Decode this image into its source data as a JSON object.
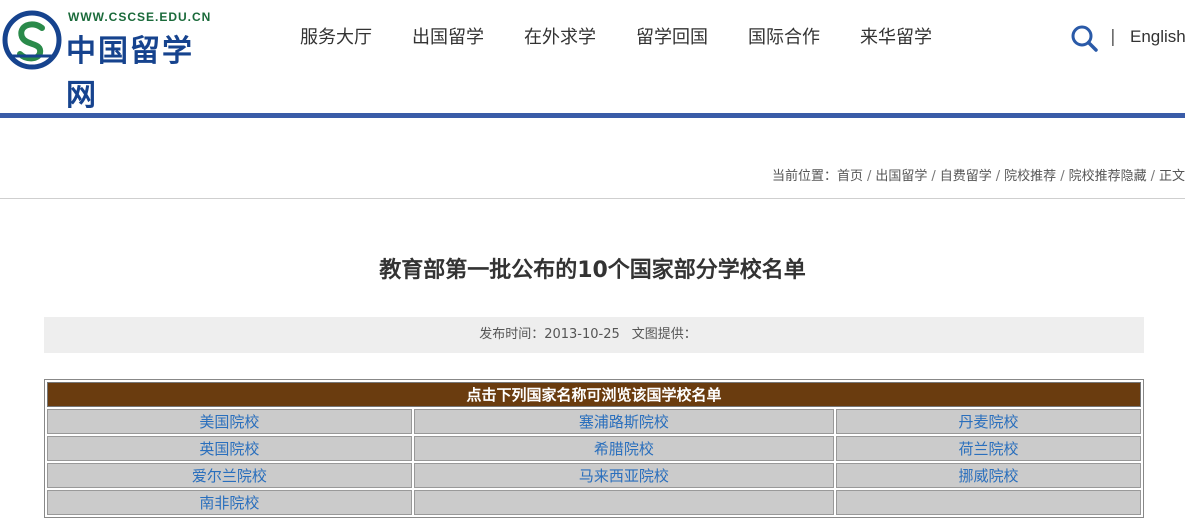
{
  "header": {
    "logo_url_text": "WWW.CSCSE.EDU.CN",
    "logo_cn_text": "中国留学网",
    "nav": [
      "服务大厅",
      "出国留学",
      "在外求学",
      "留学回国",
      "国际合作",
      "来华留学"
    ],
    "separator": "|",
    "english": "English"
  },
  "breadcrumb": {
    "prefix": "当前位置：",
    "items": [
      "首页",
      "出国留学",
      "自费留学",
      "院校推荐",
      "院校推荐隐藏",
      "正文"
    ]
  },
  "article": {
    "title": "教育部第一批公布的10个国家部分学校名单",
    "publish_label": "发布时间：2013-10-25",
    "source_label": "文图提供："
  },
  "table": {
    "header": "点击下列国家名称可浏览该国学校名单",
    "rows": [
      [
        "美国院校",
        "塞浦路斯院校",
        "丹麦院校"
      ],
      [
        "英国院校",
        "希腊院校",
        "荷兰院校"
      ],
      [
        "爱尔兰院校",
        "马来西亚院校",
        "挪威院校"
      ],
      [
        "南非院校",
        "",
        ""
      ]
    ]
  },
  "colors": {
    "accent_bar": "#3a5ca8",
    "table_header": "#6a3c0f",
    "link": "#2a6fbd",
    "logo_blue": "#16438e"
  },
  "icons": [
    "logo-mark-icon",
    "search-icon"
  ]
}
